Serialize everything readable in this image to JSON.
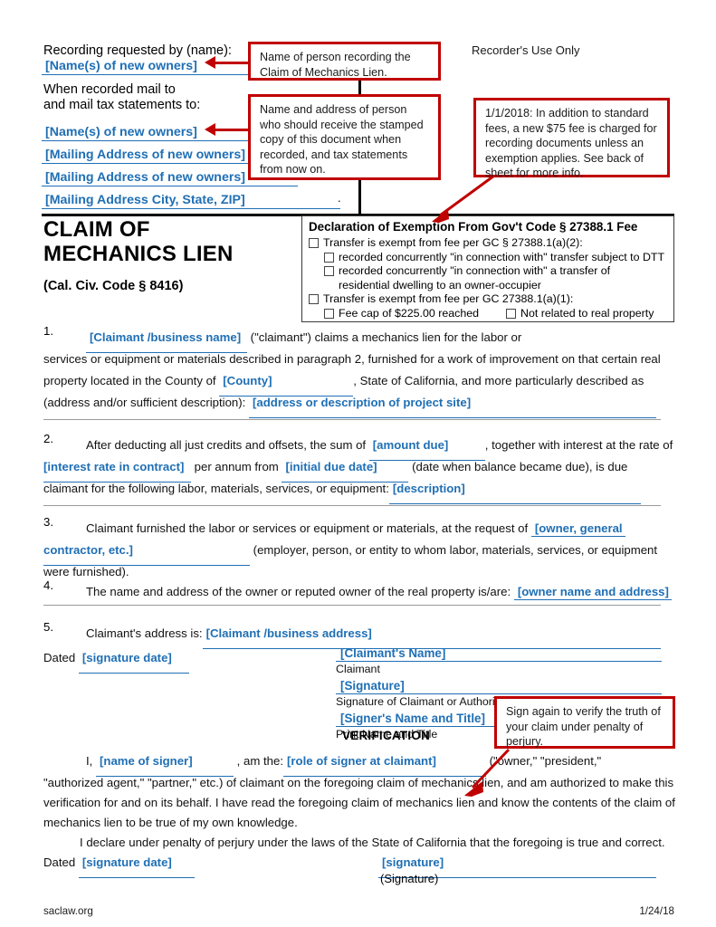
{
  "header": {
    "recording_requested_label": "Recording requested by (name):",
    "recording_requested_value": "[Name(s) of new owners]",
    "mail_to_label_line1": "When recorded mail to",
    "mail_to_label_line2": "and mail tax statements to:",
    "mail_lines": [
      "[Name(s) of new owners]",
      "[Mailing Address of new owners]",
      "[Mailing Address of new owners]",
      "[Mailing Address City, State, ZIP]"
    ],
    "recorders_use_only": "Recorder's Use Only"
  },
  "callouts": {
    "name_of_person": "Name of person recording the Claim of Mechanics Lien.",
    "name_and_address": "Name and address of person who should receive the stamped copy of this document when recorded, and tax statements from now on.",
    "fee_notice": "1/1/2018: In addition to standard fees, a new $75 fee is charged for recording documents unless an exemption applies. See back of sheet for more info.",
    "sign_again": "Sign again to verify the truth of your claim under penalty of perjury."
  },
  "title": {
    "line1": "CLAIM OF",
    "line2": "MECHANICS LIEN",
    "code": "(Cal. Civ. Code § 8416)"
  },
  "exemption": {
    "title": "Declaration of Exemption From Gov't Code § 27388.1 Fee",
    "item1": "Transfer is exempt from fee per GC § 27388.1(a)(2):",
    "item1a": "recorded concurrently \"in connection with\" transfer subject to DTT",
    "item1b": "recorded concurrently \"in connection with\" a transfer of",
    "item1b_cont": "residential dwelling to an owner-occupier",
    "item2": "Transfer is exempt from fee per GC 27388.1(a)(1):",
    "item2a": "Fee cap of $225.00 reached",
    "item2b": "Not related to real property"
  },
  "paragraphs": {
    "p1": {
      "num": "1.",
      "f_claimant": "[Claimant /business name]",
      "t1": "(\"claimant\") claims a mechanics lien for the labor or",
      "t2": "services or equipment or materials described in paragraph 2, furnished for a work of improvement on that certain real",
      "t3a": "property located in the County of",
      "f_county": "[County]",
      "t3b": ", State of California, and more  particularly described as",
      "t4a": "(address and/or sufficient description):",
      "f_address": "[address or description of project site]"
    },
    "p2": {
      "num": "2.",
      "t1a": "After deducting all just credits and offsets, the sum of",
      "f_amount": "[amount due]",
      "t1b": ", together with interest at the rate of",
      "f_rate": "[interest rate in contract]",
      "t2a": "per annum from",
      "f_due_date": "[initial due date]",
      "t2b": "(date when balance became due), is due",
      "t3a": "claimant for the following labor, materials, services, or equipment:",
      "f_description": "[description]"
    },
    "p3": {
      "num": "3.",
      "t1a": "Claimant furnished the labor or services or equipment or materials, at the request of",
      "f_owner1": "[owner, general",
      "f_owner2": "contractor, etc.]",
      "t2": "(employer, person, or entity to whom labor, materials, services, or equipment",
      "t3": "were furnished)."
    },
    "p4": {
      "num": "4.",
      "t1": "The name and address of the owner or reputed owner of the real property is/are:",
      "f_owner_addr": "[owner name and address]"
    },
    "p5": {
      "num": "5.",
      "t1": "Claimant's address is:",
      "f_claimant_addr": "[Claimant /business address]"
    }
  },
  "signature_block": {
    "dated_label": "Dated",
    "f_signature_date": "[signature date]",
    "f_claimant_name": "[Claimant's Name]",
    "caption_claimant": "Claimant",
    "f_signature": "[Signature]",
    "caption_signature": "Signature of Claimant or Authorized Agent",
    "f_signer_name_title": "[Signer's Name and Title]",
    "caption_print": "Print Name and Title",
    "verification_heading": "VERIFICATION"
  },
  "verification": {
    "t1a": "I,",
    "f_name_of_signer": "[name of signer]",
    "t1b": ", am the:",
    "f_role": "[role of signer at claimant]",
    "t1c": "(\"owner,\"  \"president,\"",
    "t2": "\"authorized agent,\" \"partner,\" etc.) of claimant on the foregoing claim of mechanics lien, and am authorized to make this",
    "t3": "verification for and on its behalf. I have read the foregoing claim of mechanics lien and know the contents of the claim of",
    "t4": "mechanics lien to be true of my own knowledge.",
    "t5": "I declare under penalty of perjury under the laws of the State of California that the foregoing is true and correct.",
    "dated_label": "Dated",
    "f_signature_date": "[signature date]",
    "f_signature": "[signature]",
    "caption_signature": "(Signature)"
  },
  "footer": {
    "site": "saclaw.org",
    "date": "1/24/18"
  },
  "colors": {
    "fill_blue": "#1F6FB5",
    "annotation_red": "#C00000",
    "rule_gray": "#9a9a9a"
  }
}
